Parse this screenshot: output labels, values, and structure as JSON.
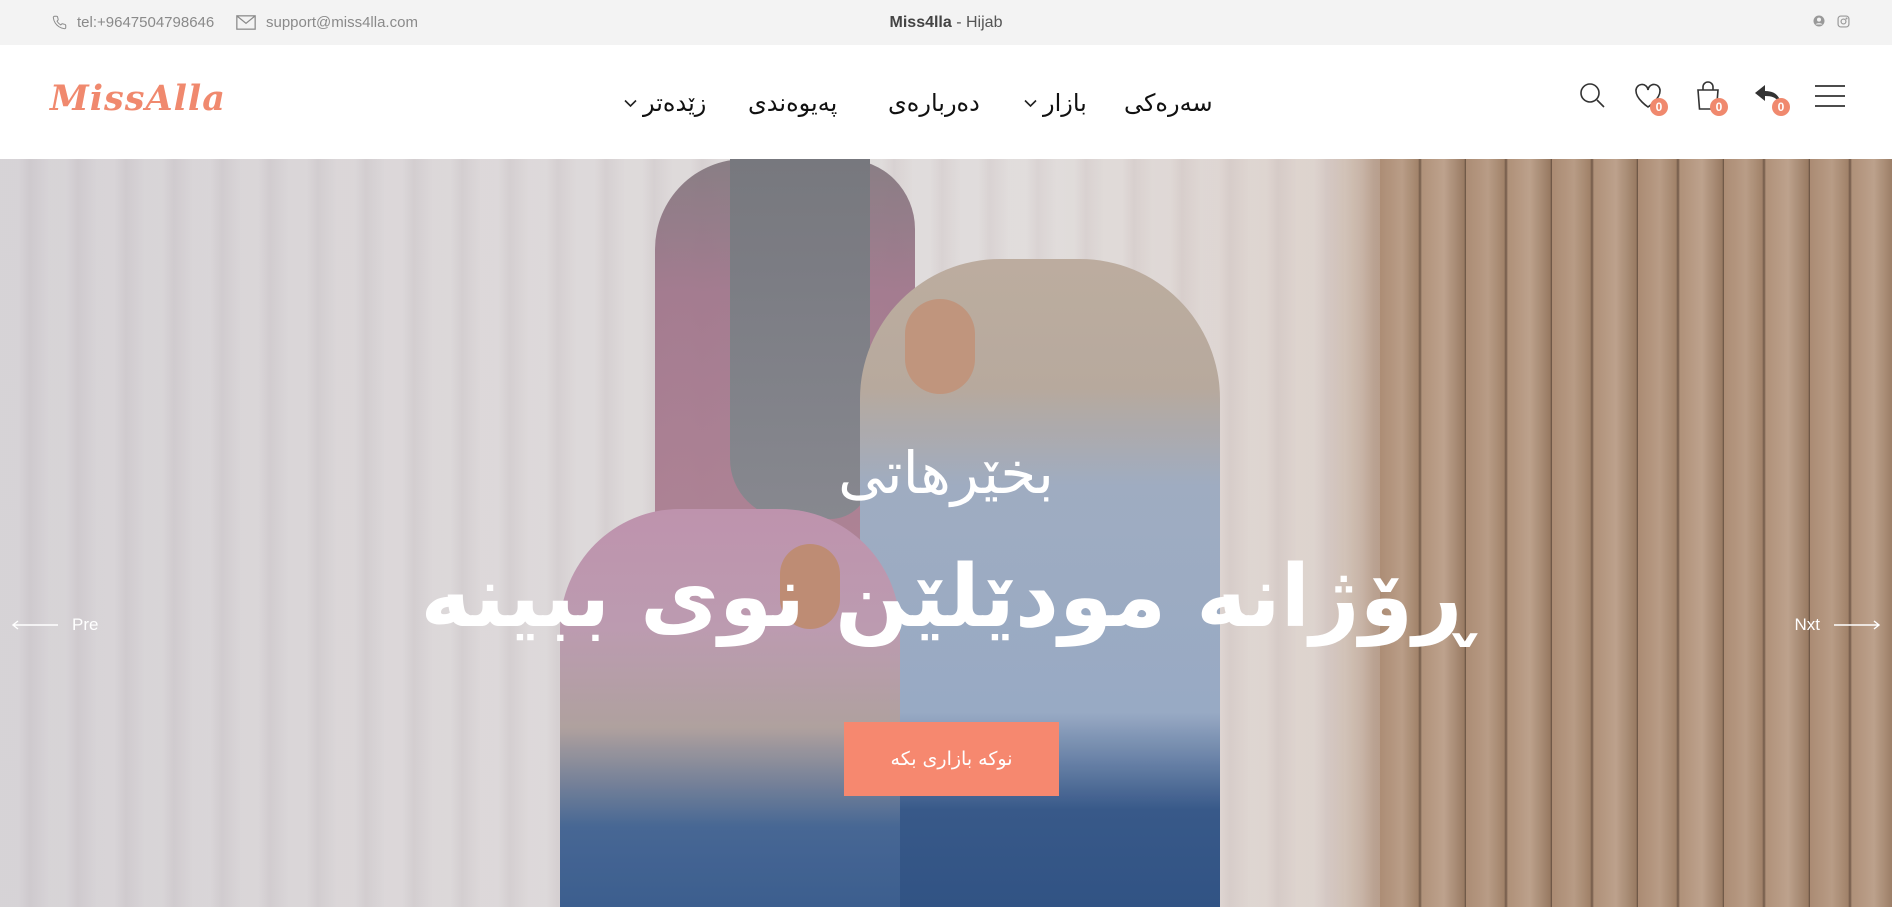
{
  "topbar": {
    "phone": "tel:+9647504798646",
    "email": "support@miss4lla.com",
    "site_name": "Miss4lla",
    "site_suffix": " - Hijab",
    "social_icons": [
      "user-circle-icon",
      "instagram-icon"
    ]
  },
  "header": {
    "logo": "MissAlla",
    "nav": {
      "home": "سەرەکی",
      "shop": "بازار",
      "about": "دەربارەی",
      "contact": "پەیوەندی",
      "more": "زێدەتر"
    },
    "wishlist_count": "0",
    "cart_count": "0",
    "compare_count": "0"
  },
  "hero": {
    "welcome": "بخێرهاتی",
    "headline": "ڕۆژانە مودێلێن نوی ببینە",
    "cta": "نوکە بازاری بکە",
    "prev": "Pre",
    "next": "Nxt"
  },
  "colors": {
    "accent": "#f0896e",
    "cta": "#f6886f"
  }
}
